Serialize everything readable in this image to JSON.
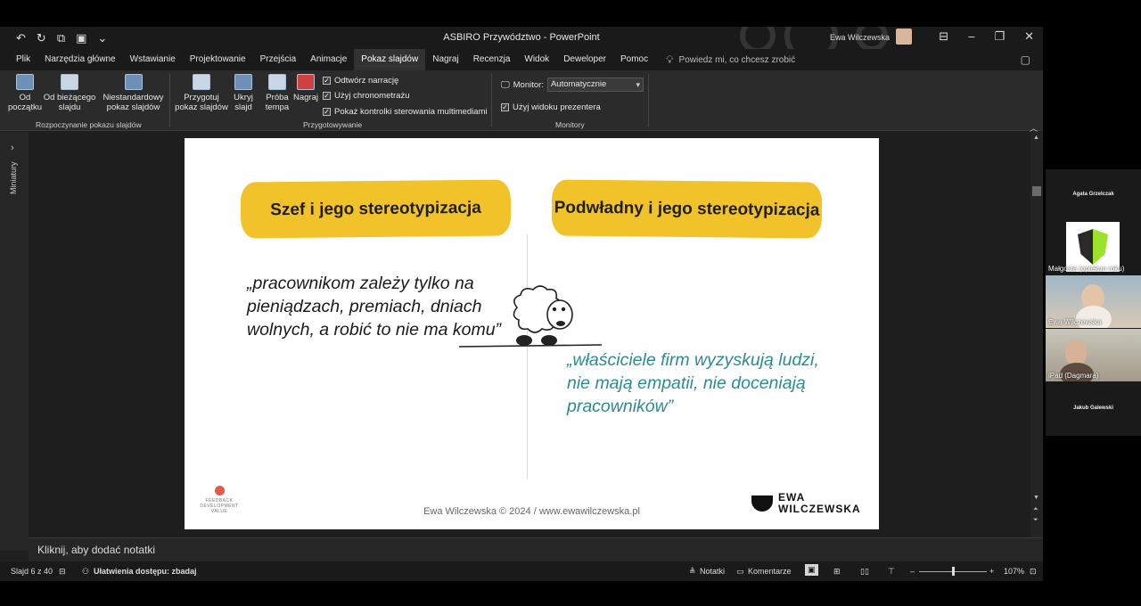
{
  "window": {
    "title": "ASBIRO Przywództwo - PowerPoint",
    "user_name": "Ewa Wilczewska"
  },
  "tabs": [
    "Plik",
    "Narzędzia główne",
    "Wstawianie",
    "Projektowanie",
    "Przejścia",
    "Animacje",
    "Pokaz slajdów",
    "Nagraj",
    "Recenzja",
    "Widok",
    "Deweloper",
    "Pomoc"
  ],
  "active_tab": "Pokaz slajdów",
  "tell_me": "Powiedz mi, co chcesz zrobić",
  "ribbon": {
    "start": {
      "from_beginning": "Od początku",
      "from_current": "Od bieżącego slajdu",
      "custom": "Niestandardowy pokaz slajdów",
      "group_label": "Rozpoczynanie pokazu slajdów"
    },
    "setup": {
      "setup_show": "Przygotuj pokaz slajdów",
      "hide_slide": "Ukryj slajd",
      "rehearse": "Próba tempa",
      "record": "Nagraj",
      "play_narration": "Odtwórz narrację",
      "use_timings": "Użyj chronometrażu",
      "show_media_controls": "Pokaż kontrolki sterowania multimediami",
      "group_label": "Przygotowywanie"
    },
    "monitors": {
      "monitor_label": "Monitor:",
      "monitor_value": "Automatycznie",
      "presenter_view": "Użyj widoku prezentera",
      "group_label": "Monitory"
    }
  },
  "side_panel": {
    "label": "Miniatury"
  },
  "slide": {
    "left_heading": "Szef i jego stereotypizacja",
    "right_heading": "Podwładny i jego stereotypizacja",
    "left_quote": "„pracownikom zależy tylko na pieniądzach, premiach, dniach wolnych, a robić to nie ma komu”",
    "right_quote": "„właściciele firm wyzyskują ludzi, nie mają empatii, nie doceniają pracowników”",
    "footer": "Ewa Wilczewska © 2024 / www.ewawilczewska.pl",
    "logo_fdv": "FEEDBACK DEVELOPMENT VALUE",
    "logo_ew_1": "EWA",
    "logo_ew_2": "WILCZEWSKA"
  },
  "notes_placeholder": "Kliknij, aby dodać notatki",
  "status": {
    "slide_counter": "Slajd 6 z 40",
    "accessibility": "Ułatwienia dostępu: zbadaj",
    "notes": "Notatki",
    "comments": "Komentarze",
    "zoom": "107%"
  },
  "participants": [
    {
      "name": "Agata Grzelczak",
      "type": "name-only"
    },
    {
      "name": "Małgosia (opiekun roku)",
      "type": "logo"
    },
    {
      "name": "Ewa Wilczewska",
      "type": "video"
    },
    {
      "name": "iPad (Dagmara)",
      "type": "video"
    },
    {
      "name": "Jakub Galewski",
      "type": "name-only"
    }
  ],
  "colors": {
    "pill": "#f2c22a",
    "quote_teal": "#2b8c92",
    "ribbon_bg": "#2b2b2b",
    "active_tab": "#323232"
  }
}
